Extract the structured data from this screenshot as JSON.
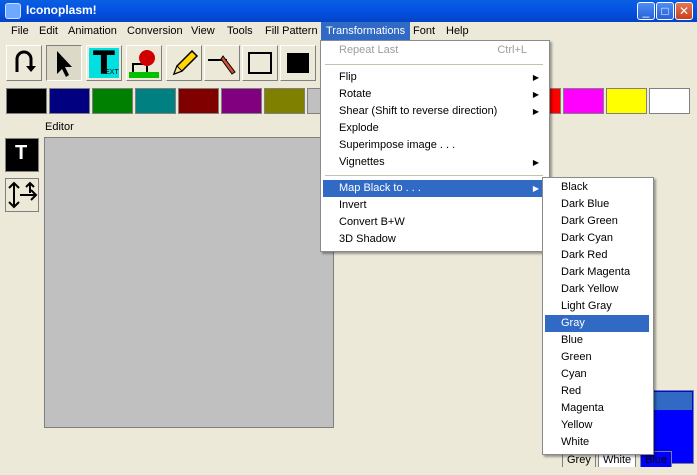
{
  "window": {
    "title": "Iconoplasm!"
  },
  "window_controls": {
    "minimize": "_",
    "maximize": "□",
    "close": "✕"
  },
  "menubar": {
    "items": [
      "File",
      "Edit",
      "Animation",
      "Conversion",
      "View",
      "Tools",
      "Fill Pattern",
      "Transformations",
      "Font",
      "Help"
    ],
    "active": "Transformations"
  },
  "toolbar": {
    "tools": [
      "undo-icon",
      "pointer-icon",
      "text-tool-icon",
      "fill-bucket-icon",
      "pencil-icon",
      "line-icon",
      "rectangle-outline-icon",
      "rectangle-filled-icon"
    ],
    "text_tool_label": "T",
    "text_tool_sub": "EXT"
  },
  "palette": {
    "colors": [
      "#000000",
      "#000080",
      "#008000",
      "#008080",
      "#800000",
      "#800080",
      "#808000",
      "#c0c0c0",
      "#ff0000",
      "#ff00ff",
      "#ffff00",
      "#ffffff"
    ]
  },
  "sidebar": {
    "text_tool_label": "T",
    "move_icon": "four-arrows-icon"
  },
  "editor": {
    "label": "Editor"
  },
  "transformations_menu": {
    "items": [
      {
        "label": "Repeat Last",
        "shortcut": "Ctrl+L",
        "disabled": true
      },
      {
        "separator": true
      },
      {
        "label": "Flip",
        "submenu": true
      },
      {
        "label": "Rotate",
        "submenu": true
      },
      {
        "label": "Shear (Shift to reverse direction)",
        "submenu": true
      },
      {
        "label": "Explode"
      },
      {
        "label": "Superimpose image . . ."
      },
      {
        "label": "Vignettes",
        "submenu": true
      },
      {
        "separator": true
      },
      {
        "label": "Map Black to . . .",
        "submenu": true,
        "highlighted": true
      },
      {
        "label": "Invert"
      },
      {
        "label": "Convert B+W"
      },
      {
        "label": "3D Shadow"
      }
    ]
  },
  "map_black_submenu": {
    "items": [
      "Black",
      "Dark Blue",
      "Dark Green",
      "Dark Cyan",
      "Dark Red",
      "Dark Magenta",
      "Dark Yellow",
      "Light Gray",
      "Gray",
      "Blue",
      "Green",
      "Cyan",
      "Red",
      "Magenta",
      "Yellow",
      "White"
    ],
    "highlighted": "Gray"
  },
  "bottom_tabs": [
    "Grey",
    "White",
    "Blue"
  ]
}
